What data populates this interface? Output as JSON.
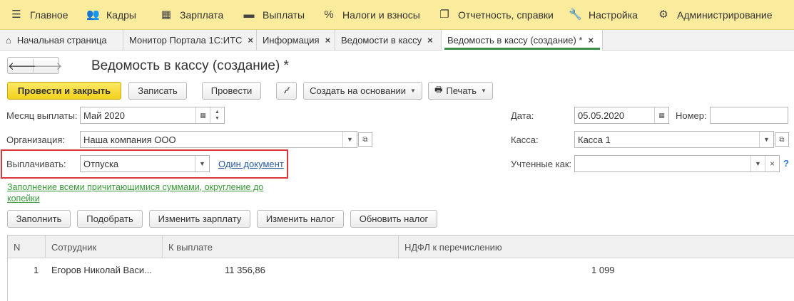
{
  "menu": {
    "items": [
      {
        "label": "Главное",
        "icon": "hamburger-icon"
      },
      {
        "label": "Кадры",
        "icon": "people-icon"
      },
      {
        "label": "Зарплата",
        "icon": "calculator-icon"
      },
      {
        "label": "Выплаты",
        "icon": "wallet-icon"
      },
      {
        "label": "Налоги и взносы",
        "icon": "percent-icon"
      },
      {
        "label": "Отчетность, справки",
        "icon": "reports-icon"
      },
      {
        "label": "Настройка",
        "icon": "wrench-icon"
      },
      {
        "label": "Администрирование",
        "icon": "gear-icon"
      }
    ]
  },
  "tabs": {
    "items": [
      {
        "label": "Начальная страница"
      },
      {
        "label": "Монитор Портала 1С:ИТС"
      },
      {
        "label": "Информация"
      },
      {
        "label": "Ведомости в кассу"
      },
      {
        "label": "Ведомость в кассу (создание) *"
      }
    ]
  },
  "document": {
    "title": "Ведомость в кассу (создание) *"
  },
  "toolbar": {
    "post_close": "Провести и закрыть",
    "save": "Записать",
    "post": "Провести",
    "create_based": "Создать на основании",
    "print": "Печать"
  },
  "form": {
    "month_label": "Месяц выплаты:",
    "month_value": "Май 2020",
    "org_label": "Организация:",
    "org_value": "Наша компания ООО",
    "pay_label": "Выплачивать:",
    "pay_value": "Отпуска",
    "one_doc_link": "Один документ",
    "date_label": "Дата:",
    "date_value": "05.05.2020",
    "number_label": "Номер:",
    "number_value": "",
    "cash_label": "Касса:",
    "cash_value": "Касса 1",
    "counted_label": "Учтенные как:",
    "counted_value": "",
    "help": "?",
    "fill_link": "Заполнение всеми причитающимися суммами, округление до копейки"
  },
  "actions": {
    "fill": "Заполнить",
    "select": "Подобрать",
    "change_salary": "Изменить зарплату",
    "change_tax": "Изменить налог",
    "update_tax": "Обновить налог"
  },
  "table": {
    "columns": [
      "N",
      "Сотрудник",
      "К выплате",
      "НДФЛ к перечислению"
    ],
    "rows": [
      {
        "n": "1",
        "employee": "Егоров Николай Васи...",
        "amount": "11 356,86",
        "ndfl": "1 099"
      }
    ]
  }
}
